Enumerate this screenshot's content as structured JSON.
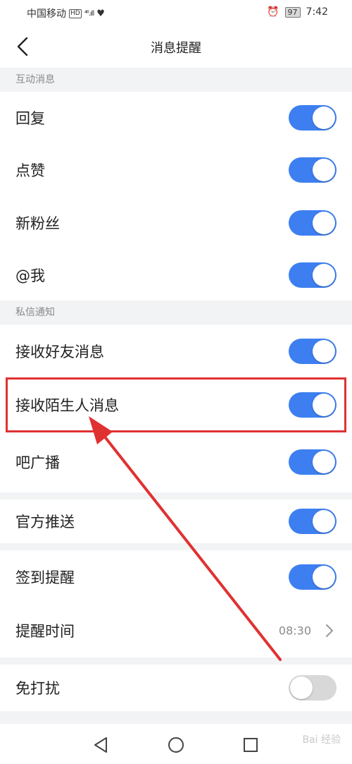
{
  "status_bar": {
    "carrier": "中国移动",
    "hd": "HD",
    "network": "⁴⁶.ıll",
    "battery": "97",
    "time": "7:42"
  },
  "header": {
    "title": "消息提醒",
    "back_icon": "chevron-left-icon"
  },
  "sections": {
    "interactive": {
      "title": "互动消息",
      "items": [
        {
          "label": "回复",
          "toggle": true
        },
        {
          "label": "点赞",
          "toggle": true
        },
        {
          "label": "新粉丝",
          "toggle": true
        },
        {
          "label": "@我",
          "toggle": true
        }
      ]
    },
    "private": {
      "title": "私信通知",
      "items": [
        {
          "label": "接收好友消息",
          "toggle": true
        },
        {
          "label": "接收陌生人消息",
          "toggle": true
        }
      ]
    },
    "other": {
      "bar_broadcast": {
        "label": "吧广播",
        "toggle": true
      },
      "official_push": {
        "label": "官方推送",
        "toggle": true
      },
      "checkin_reminder": {
        "label": "签到提醒",
        "toggle": true
      },
      "reminder_time": {
        "label": "提醒时间",
        "value": "08:30"
      },
      "do_not_disturb": {
        "label": "免打扰",
        "toggle": false
      }
    }
  },
  "bottom_nav": {
    "watermark": "Bai 经验",
    "icons": [
      "back-triangle-icon",
      "home-circle-icon",
      "recent-square-icon"
    ]
  },
  "colors": {
    "toggle_on": "#3d7ff0",
    "toggle_off": "#d8d8d8",
    "highlight": "#e03131",
    "background": "#f2f3f5"
  }
}
